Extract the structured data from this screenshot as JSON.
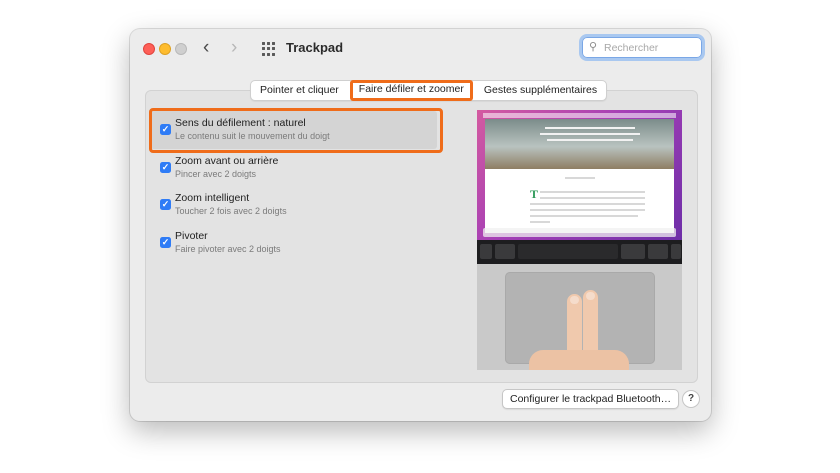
{
  "window": {
    "title": "Trackpad"
  },
  "search": {
    "placeholder": "Rechercher"
  },
  "tabs": [
    {
      "label": "Pointer et cliquer",
      "active": false
    },
    {
      "label": "Faire défiler et zoomer",
      "active": true
    },
    {
      "label": "Gestes supplémentaires",
      "active": false
    }
  ],
  "options": [
    {
      "title": "Sens du défilement : naturel",
      "description": "Le contenu suit le mouvement du doigt",
      "checked": true,
      "highlighted": true
    },
    {
      "title": "Zoom avant ou arrière",
      "description": "Pincer avec 2 doigts",
      "checked": true,
      "highlighted": false
    },
    {
      "title": "Zoom intelligent",
      "description": "Toucher 2 fois avec 2 doigts",
      "checked": true,
      "highlighted": false
    },
    {
      "title": "Pivoter",
      "description": "Faire pivoter avec 2 doigts",
      "checked": true,
      "highlighted": false
    }
  ],
  "buttons": {
    "configure": "Configurer le trackpad Bluetooth…",
    "help": "?"
  },
  "colors": {
    "accent": "#2f7cf6",
    "highlight": "#ef6c1a"
  }
}
